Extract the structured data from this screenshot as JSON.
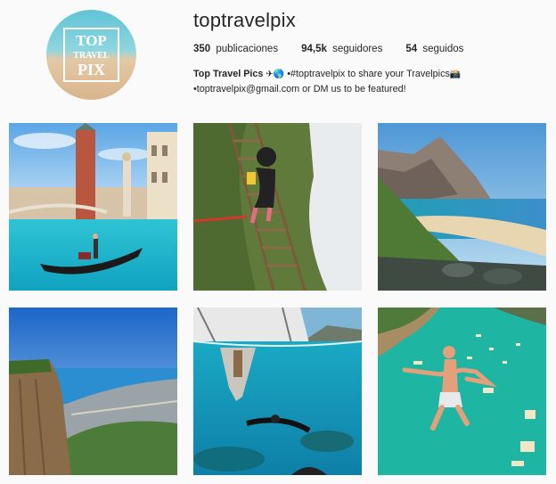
{
  "profile": {
    "username": "toptravelpix",
    "avatar_logo": {
      "line1": "TOP",
      "line2": "TRAVEL",
      "line3": "PIX"
    },
    "stats": [
      {
        "value": "350",
        "label": "publicaciones"
      },
      {
        "value": "94,5k",
        "label": "seguidores"
      },
      {
        "value": "54",
        "label": "seguidos"
      }
    ],
    "bio": {
      "name": "Top Travel Pics",
      "name_emojis": "✈🌎",
      "line1_text": "•#toptravelpix to share your Travelpics",
      "line1_emoji": "📸",
      "line2_text": "•toptravelpix@gmail.com or DM us to be featured!"
    }
  },
  "posts": [
    {
      "icon": "venice-gondola-photo"
    },
    {
      "icon": "cliff-ladder-photo"
    },
    {
      "icon": "coastal-cliffs-beach-photo"
    },
    {
      "icon": "rio-coastline-photo"
    },
    {
      "icon": "boat-underwater-snorkel-photo"
    },
    {
      "icon": "cliff-jump-lagoon-photo"
    }
  ],
  "colors": {
    "background": "#fafafa",
    "text": "#262626",
    "lagoon": "#1fb5a3",
    "sky": "#4aa3e0"
  }
}
